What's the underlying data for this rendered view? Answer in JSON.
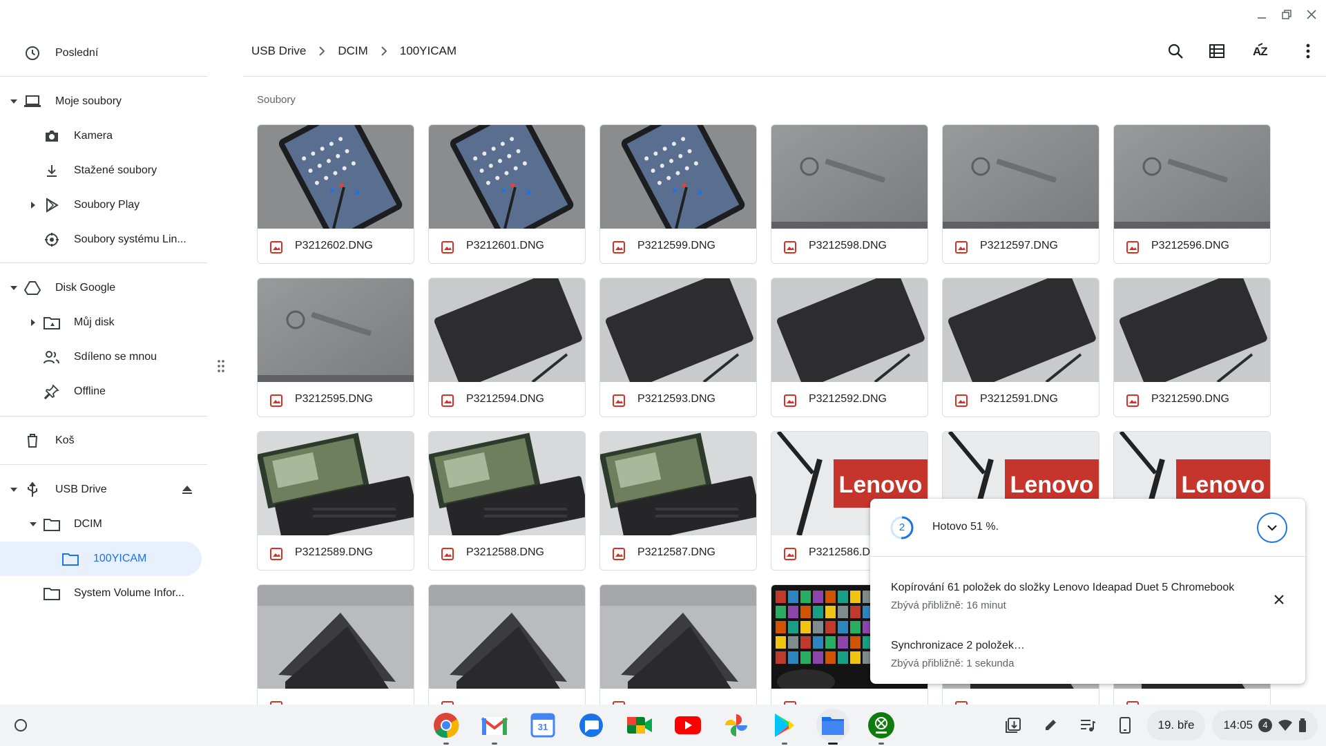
{
  "sidebar": {
    "recent": "Poslední",
    "my_files": "Moje soubory",
    "camera": "Kamera",
    "downloads": "Stažené soubory",
    "play_files": "Soubory Play",
    "linux_files": "Soubory systému Lin...",
    "google_drive": "Disk Google",
    "my_drive": "Můj disk",
    "shared": "Sdíleno se mnou",
    "offline": "Offline",
    "trash": "Koš",
    "usb_drive": "USB Drive",
    "dcim": "DCIM",
    "folder_100": "100YICAM",
    "system_volume": "System Volume Infor..."
  },
  "breadcrumb": [
    "USB Drive",
    "DCIM",
    "100YICAM"
  ],
  "header": {
    "sort_label": "AZ"
  },
  "section_label": "Soubory",
  "files": [
    {
      "name": "P3212602.DNG",
      "thumb": "tablet-screen"
    },
    {
      "name": "P3212601.DNG",
      "thumb": "tablet-screen"
    },
    {
      "name": "P3212599.DNG",
      "thumb": "tablet-screen"
    },
    {
      "name": "P3212598.DNG",
      "thumb": "chromebook-lid"
    },
    {
      "name": "P3212597.DNG",
      "thumb": "chromebook-lid"
    },
    {
      "name": "P3212596.DNG",
      "thumb": "chromebook-lid"
    },
    {
      "name": "P3212595.DNG",
      "thumb": "chromebook-lid"
    },
    {
      "name": "P3212594.DNG",
      "thumb": "keyboard-dark"
    },
    {
      "name": "P3212593.DNG",
      "thumb": "keyboard-dark"
    },
    {
      "name": "P3212592.DNG",
      "thumb": "keyboard-dark"
    },
    {
      "name": "P3212591.DNG",
      "thumb": "keyboard-dark"
    },
    {
      "name": "P3212590.DNG",
      "thumb": "keyboard-dark"
    },
    {
      "name": "P3212589.DNG",
      "thumb": "laptop-open"
    },
    {
      "name": "P3212588.DNG",
      "thumb": "laptop-open"
    },
    {
      "name": "P3212587.DNG",
      "thumb": "laptop-open"
    },
    {
      "name": "P3212586.DNG",
      "thumb": "lenovo-box"
    },
    {
      "name": "",
      "thumb": "lenovo-box"
    },
    {
      "name": "",
      "thumb": "lenovo-box"
    },
    {
      "name": "",
      "thumb": "kickstand"
    },
    {
      "name": "",
      "thumb": "kickstand"
    },
    {
      "name": "",
      "thumb": "kickstand"
    },
    {
      "name": "",
      "thumb": "game-screen"
    },
    {
      "name": "",
      "thumb": "kickstand"
    },
    {
      "name": "",
      "thumb": "kickstand"
    }
  ],
  "progress": {
    "count": "2",
    "status": "Hotovo 51 %.",
    "percent": 51,
    "ops": [
      {
        "title": "Kopírování 61 položek do složky Lenovo Ideapad Duet 5 Chromebook",
        "sub": "Zbývá přibližně: 16 minut"
      },
      {
        "title": "Synchronizace 2 položek…",
        "sub": "Zbývá přibližně: 1 sekunda"
      }
    ]
  },
  "shelf": {
    "apps": [
      "chrome-icon",
      "gmail-icon",
      "calendar-icon",
      "messages-icon",
      "meet-icon",
      "youtube-icon",
      "photos-icon",
      "play-store-icon",
      "files-icon",
      "game-pass-icon"
    ],
    "calendar_day": "31",
    "date": "19. bře",
    "time": "14:05",
    "notification_count": "4"
  },
  "colors": {
    "accent": "#1a73e8",
    "active_bg": "#e8f0fe",
    "file_icon": "#d93025"
  }
}
